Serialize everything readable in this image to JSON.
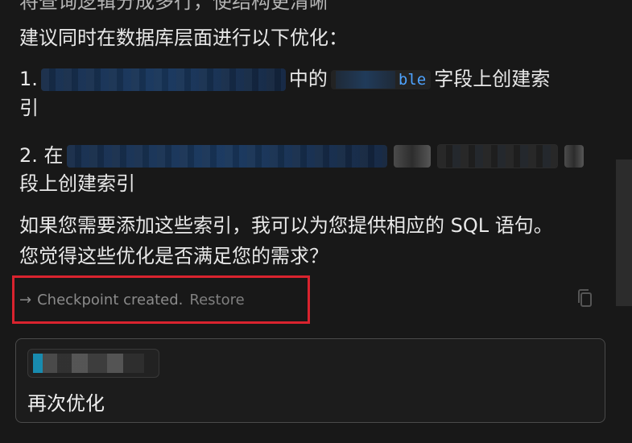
{
  "conversation": {
    "partial_top_text": "将查询逻辑分成多行，使结构更清晰",
    "intro": "建议同时在数据库层面进行以下优化：",
    "item1_prefix": "1.",
    "item1_mid": "中的",
    "item1_code": "ble",
    "item1_suffix_a": "字段上创建索",
    "item1_suffix_b": "引",
    "item2_prefix": "2. 在",
    "item2_suffix": "段上创建索引",
    "sql_prompt": "如果您需要添加这些索引，我可以为您提供相应的 SQL 语句。",
    "question": "您觉得这些优化是否满足您的需求？"
  },
  "checkpoint": {
    "arrow_icon": "→",
    "label": "Checkpoint created.",
    "restore": "Restore"
  },
  "composer": {
    "input_value": "再次优化"
  },
  "icons": {
    "copy": "copy-icon"
  },
  "colors": {
    "background": "#181818",
    "highlight_border": "#d9232e",
    "code_accent": "#4ea3ff"
  }
}
